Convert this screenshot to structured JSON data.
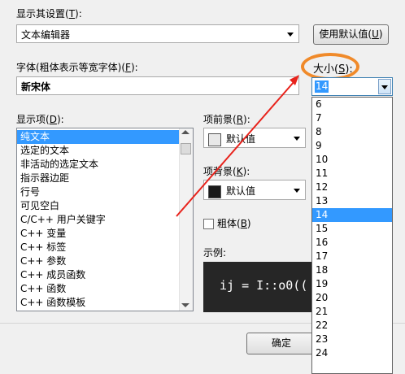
{
  "display_settings": {
    "label": "显示其设置(",
    "mnemonic": "T",
    "label_end": "):",
    "value": "文本编辑器"
  },
  "use_default_button": {
    "label": "使用默认值(",
    "mnemonic": "U",
    "label_end": ")"
  },
  "font": {
    "label": "字体(粗体表示等宽字体)(",
    "mnemonic": "F",
    "label_end": "):",
    "value": "新宋体"
  },
  "size": {
    "label": "大小(",
    "mnemonic": "S",
    "label_end": "):",
    "value": "14",
    "options": [
      "6",
      "7",
      "8",
      "9",
      "10",
      "11",
      "12",
      "13",
      "14",
      "15",
      "16",
      "17",
      "18",
      "19",
      "20",
      "21",
      "22",
      "23",
      "24"
    ],
    "selected": "14"
  },
  "display_items": {
    "label": "显示项(",
    "mnemonic": "D",
    "label_end": "):",
    "items": [
      "纯文本",
      "选定的文本",
      "非活动的选定文本",
      "指示器边距",
      "行号",
      "可见空白",
      "C/C++ 用户关键字",
      "C++ 变量",
      "C++ 标签",
      "C++ 参数",
      "C++ 成员函数",
      "C++ 函数",
      "C++ 函数模板"
    ],
    "selected": "纯文本"
  },
  "foreground": {
    "label": "项前景(",
    "mnemonic": "R",
    "label_end": "):",
    "value": "默认值",
    "swatch_color": "#e8e8e8"
  },
  "background": {
    "label": "项背景(",
    "mnemonic": "K",
    "label_end": "):",
    "value": "默认值",
    "swatch_color": "#1a1a1a"
  },
  "bold": {
    "label": "粗体(",
    "mnemonic": "B",
    "label_end": ")"
  },
  "sample": {
    "label": "示例:",
    "text": "ij = I::o0(("
  },
  "ok_button": {
    "label": "确定"
  },
  "colors": {
    "highlight_circle": "#f08a2a",
    "arrow": "#e8231c",
    "selection": "#3399ff"
  }
}
